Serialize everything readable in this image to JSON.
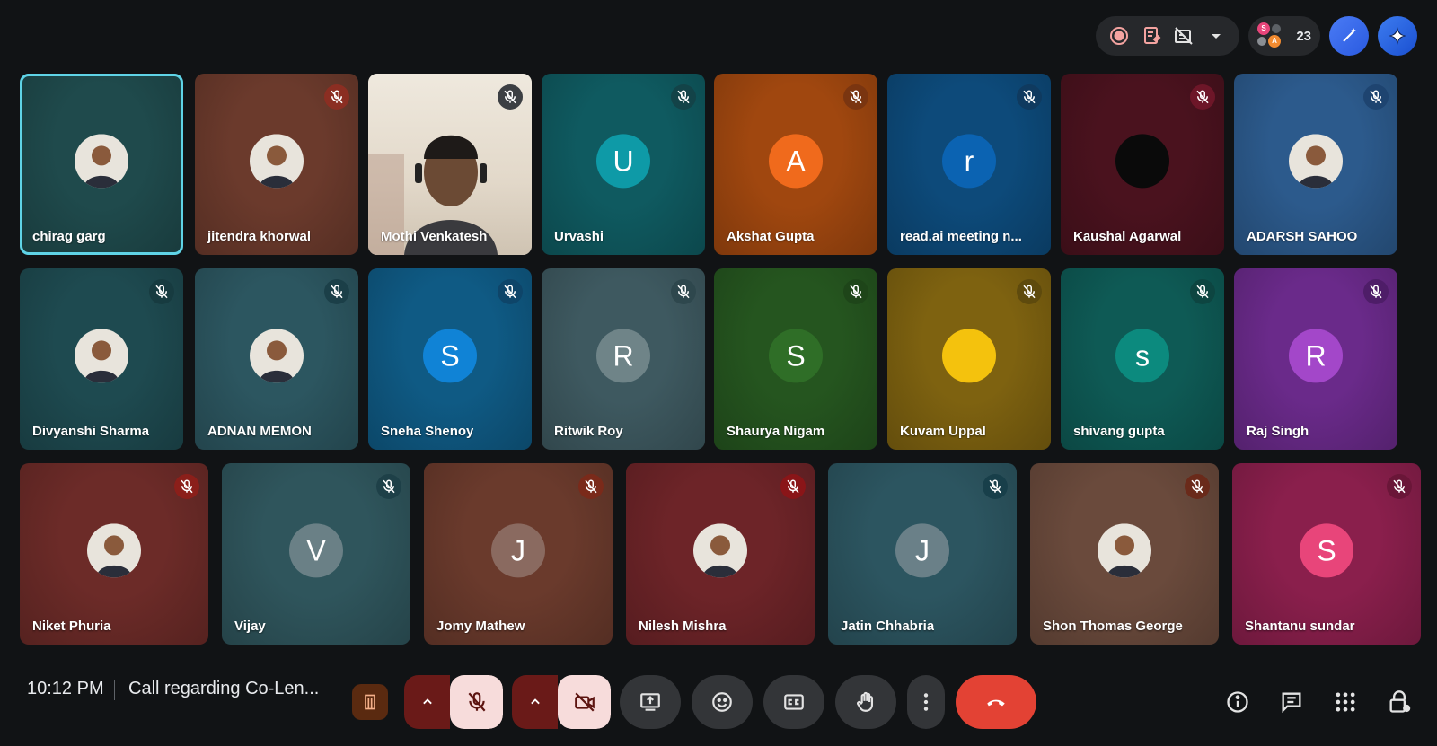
{
  "meeting": {
    "time": "10:12 PM",
    "title": "Call regarding Co-Len..."
  },
  "top_bar": {
    "participant_count": "23",
    "mini_avatars": [
      {
        "letter": "S",
        "color": "#e8457a"
      },
      {
        "letter": "A",
        "color": "#f28b30"
      }
    ],
    "icons": [
      "record-icon",
      "notes-icon",
      "captions-off-icon",
      "chevron-down-icon"
    ]
  },
  "colors": {
    "background": "#111315",
    "active_tile_outline": "#5fd3e6",
    "hangup": "#e34234",
    "mic_off_bg": "#f7dcdb"
  },
  "participants": [
    {
      "name": "chirag garg",
      "type": "photo",
      "bg": "#1f4a4c",
      "active": true,
      "muted": false
    },
    {
      "name": "jitendra khorwal",
      "type": "photo",
      "bg": "#6b3a2c",
      "muted": true,
      "mute_bg": "#8b2e22"
    },
    {
      "name": "Mothi Venkatesh",
      "type": "video",
      "bg": "#d9d3c8",
      "muted": true,
      "mute_bg": "#3c3f43"
    },
    {
      "name": "Urvashi",
      "type": "initial",
      "initial": "U",
      "bg": "#0f5a60",
      "avatar_color": "#0e9aa7",
      "muted": true,
      "mute_bg": "#134348"
    },
    {
      "name": "Akshat Gupta",
      "type": "initial",
      "initial": "A",
      "bg": "#a0470f",
      "avatar_color": "#f06a1c",
      "muted": true,
      "mute_bg": "#7a3510"
    },
    {
      "name": "read.ai meeting n...",
      "type": "initial",
      "initial": "r",
      "bg": "#0d4a7a",
      "avatar_color": "#0b63b2",
      "muted": true,
      "mute_bg": "#0f3a5f"
    },
    {
      "name": "Kaushal Agarwal",
      "type": "dark",
      "bg": "#4a121e",
      "avatar_color": "#0a0a0a",
      "muted": true,
      "mute_bg": "#6d1628"
    },
    {
      "name": "ADARSH SAHOO",
      "type": "photo",
      "bg": "#2c5a8c",
      "muted": true,
      "mute_bg": "#1e4470"
    },
    {
      "name": "Divyanshi Sharma",
      "type": "photo",
      "bg": "#1e4a50",
      "muted": true,
      "mute_bg": "#173b40"
    },
    {
      "name": "ADNAN MEMON",
      "type": "photo",
      "bg": "#2c5660",
      "muted": true,
      "mute_bg": "#1b3f48"
    },
    {
      "name": "Sneha Shenoy",
      "type": "initial",
      "initial": "S",
      "bg": "#0f5a84",
      "avatar_color": "#1083d6",
      "muted": true,
      "mute_bg": "#0e4569"
    },
    {
      "name": "Ritwik Roy",
      "type": "initial",
      "initial": "R",
      "bg": "#3e5960",
      "avatar_color": "#6f8488",
      "muted": true,
      "mute_bg": "#2e474d"
    },
    {
      "name": "Shaurya Nigam",
      "type": "initial",
      "initial": "S",
      "bg": "#25551f",
      "avatar_color": "#2f6e27",
      "muted": true,
      "mute_bg": "#1e4519"
    },
    {
      "name": "Kuvam Uppal",
      "type": "initial",
      "initial": "",
      "bg": "#7e6210",
      "avatar_color": "#f4c20d",
      "muted": true,
      "mute_bg": "#5e4a0d"
    },
    {
      "name": "shivang gupta",
      "type": "initial",
      "initial": "s",
      "bg": "#0e5a55",
      "avatar_color": "#0c8a7e",
      "muted": true,
      "mute_bg": "#0d4541"
    },
    {
      "name": "Raj Singh",
      "type": "initial",
      "initial": "R",
      "bg": "#6a2a8a",
      "avatar_color": "#a347c9",
      "muted": true,
      "mute_bg": "#4e1d68"
    },
    {
      "name": "Niket Phuria",
      "type": "photo",
      "bg": "#6c2b28",
      "muted": true,
      "mute_bg": "#8b1f1a"
    },
    {
      "name": "Vijay",
      "type": "initial",
      "initial": "V",
      "bg": "#2f555c",
      "avatar_color": "#6a8086",
      "muted": true,
      "mute_bg": "#1e4048"
    },
    {
      "name": "Jomy Mathew",
      "type": "initial",
      "initial": "J",
      "bg": "#6a3a2c",
      "avatar_color": "#8a6a60",
      "muted": true,
      "mute_bg": "#7a2a1a"
    },
    {
      "name": "Nilesh Mishra",
      "type": "photo",
      "bg": "#6d2428",
      "muted": true,
      "mute_bg": "#8a1518"
    },
    {
      "name": "Jatin Chhabria",
      "type": "initial",
      "initial": "J",
      "bg": "#2c5560",
      "avatar_color": "#6a8088",
      "muted": true,
      "mute_bg": "#183f4a"
    },
    {
      "name": "Shon Thomas George",
      "type": "photo",
      "bg": "#6a4a3c",
      "muted": true,
      "mute_bg": "#6a2a1a"
    },
    {
      "name": "Shantanu sundar",
      "type": "initial",
      "initial": "S",
      "bg": "#8a1f4c",
      "avatar_color": "#e8457a",
      "muted": true,
      "mute_bg": "#6a1638"
    }
  ]
}
